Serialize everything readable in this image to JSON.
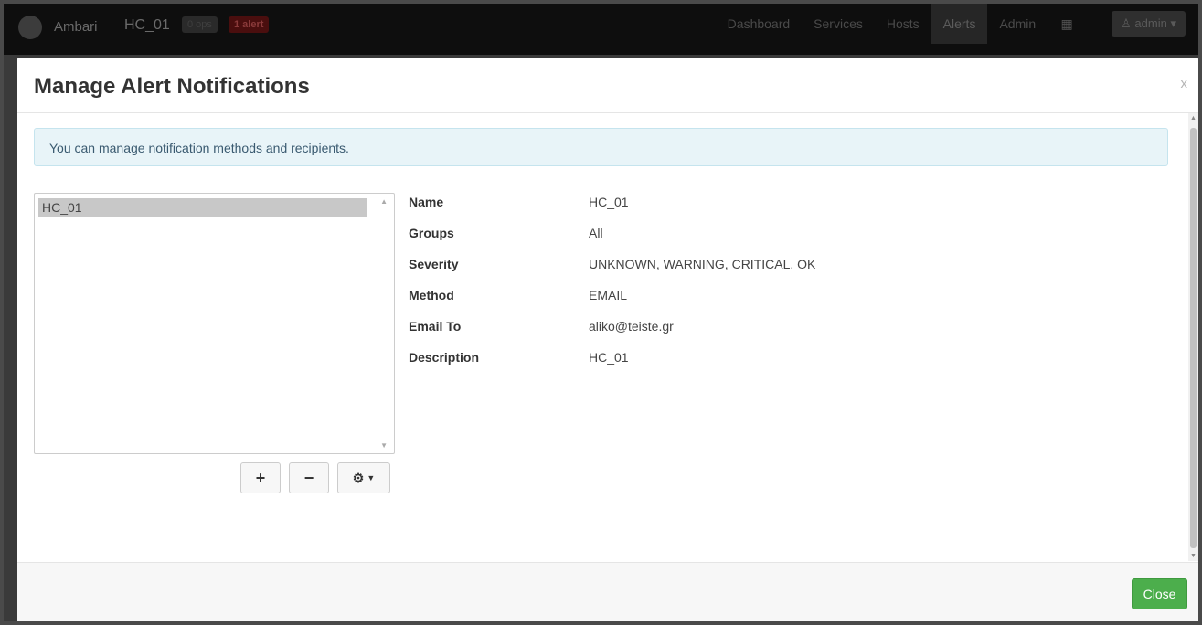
{
  "navbar": {
    "brand": "Ambari",
    "cluster_name": "HC_01",
    "ops_badge": "0 ops",
    "alert_badge": "1 alert",
    "links": [
      "Dashboard",
      "Services",
      "Hosts",
      "Alerts",
      "Admin"
    ],
    "active_link": "Alerts",
    "user_label": "admin"
  },
  "modal": {
    "title": "Manage Alert Notifications",
    "close_x": "x",
    "info_text": "You can manage notification methods and recipients.",
    "notifications": [
      "HC_01"
    ],
    "selected_notification": "HC_01",
    "details": [
      {
        "label": "Name",
        "value": "HC_01"
      },
      {
        "label": "Groups",
        "value": "All"
      },
      {
        "label": "Severity",
        "value": "UNKNOWN, WARNING, CRITICAL, OK"
      },
      {
        "label": "Method",
        "value": "EMAIL"
      },
      {
        "label": "Email To",
        "value": "aliko@teiste.gr"
      },
      {
        "label": "Description",
        "value": "HC_01"
      }
    ],
    "buttons": {
      "add": "+",
      "remove": "−",
      "settings_icon": "gear-icon"
    },
    "close_button": "Close"
  },
  "colors": {
    "close_button": "#4cae4c",
    "info_background": "#e8f4f8",
    "selected_row": "#c8c8c8"
  }
}
